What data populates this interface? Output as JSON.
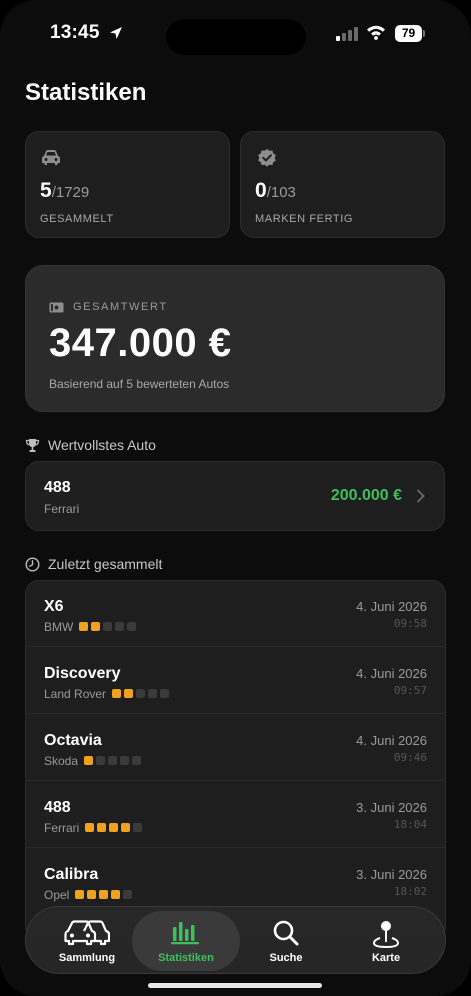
{
  "status_bar": {
    "time": "13:45",
    "battery": "79"
  },
  "page": {
    "title": "Statistiken"
  },
  "stats": {
    "collected": {
      "count": "5",
      "total": "/1729",
      "label": "GESAMMELT",
      "icon": "car-icon"
    },
    "brands": {
      "count": "0",
      "total": "/103",
      "label": "MARKEN FERTIG",
      "icon": "verified-badge-icon"
    }
  },
  "total_value": {
    "heading": "GESAMTWERT",
    "value": "347.000 €",
    "subtitle": "Basierend auf 5 bewerteten Autos"
  },
  "most_valuable": {
    "heading": "Wertvollstes Auto",
    "name": "488",
    "brand": "Ferrari",
    "value": "200.000 €"
  },
  "recent": {
    "heading": "Zuletzt gesammelt",
    "items": [
      {
        "name": "X6",
        "brand": "BMW",
        "rating": 2,
        "date": "4. Juni 2026",
        "time": "09:58"
      },
      {
        "name": "Discovery",
        "brand": "Land Rover",
        "rating": 2,
        "date": "4. Juni 2026",
        "time": "09:57"
      },
      {
        "name": "Octavia",
        "brand": "Skoda",
        "rating": 1,
        "date": "4. Juni 2026",
        "time": "09:46"
      },
      {
        "name": "488",
        "brand": "Ferrari",
        "rating": 4,
        "date": "3. Juni 2026",
        "time": "18:04"
      },
      {
        "name": "Calibra",
        "brand": "Opel",
        "rating": 4,
        "date": "3. Juni 2026",
        "time": "18:02"
      }
    ]
  },
  "tabs": [
    {
      "label": "Sammlung",
      "icon": "cars-icon"
    },
    {
      "label": "Statistiken",
      "icon": "bar-chart-icon",
      "active": true
    },
    {
      "label": "Suche",
      "icon": "search-icon"
    },
    {
      "label": "Karte",
      "icon": "map-pin-icon"
    }
  ],
  "colors": {
    "accent": "#3fbf5f",
    "rating_on": "#f0a21e",
    "card_bg": "#1e1e1e"
  }
}
